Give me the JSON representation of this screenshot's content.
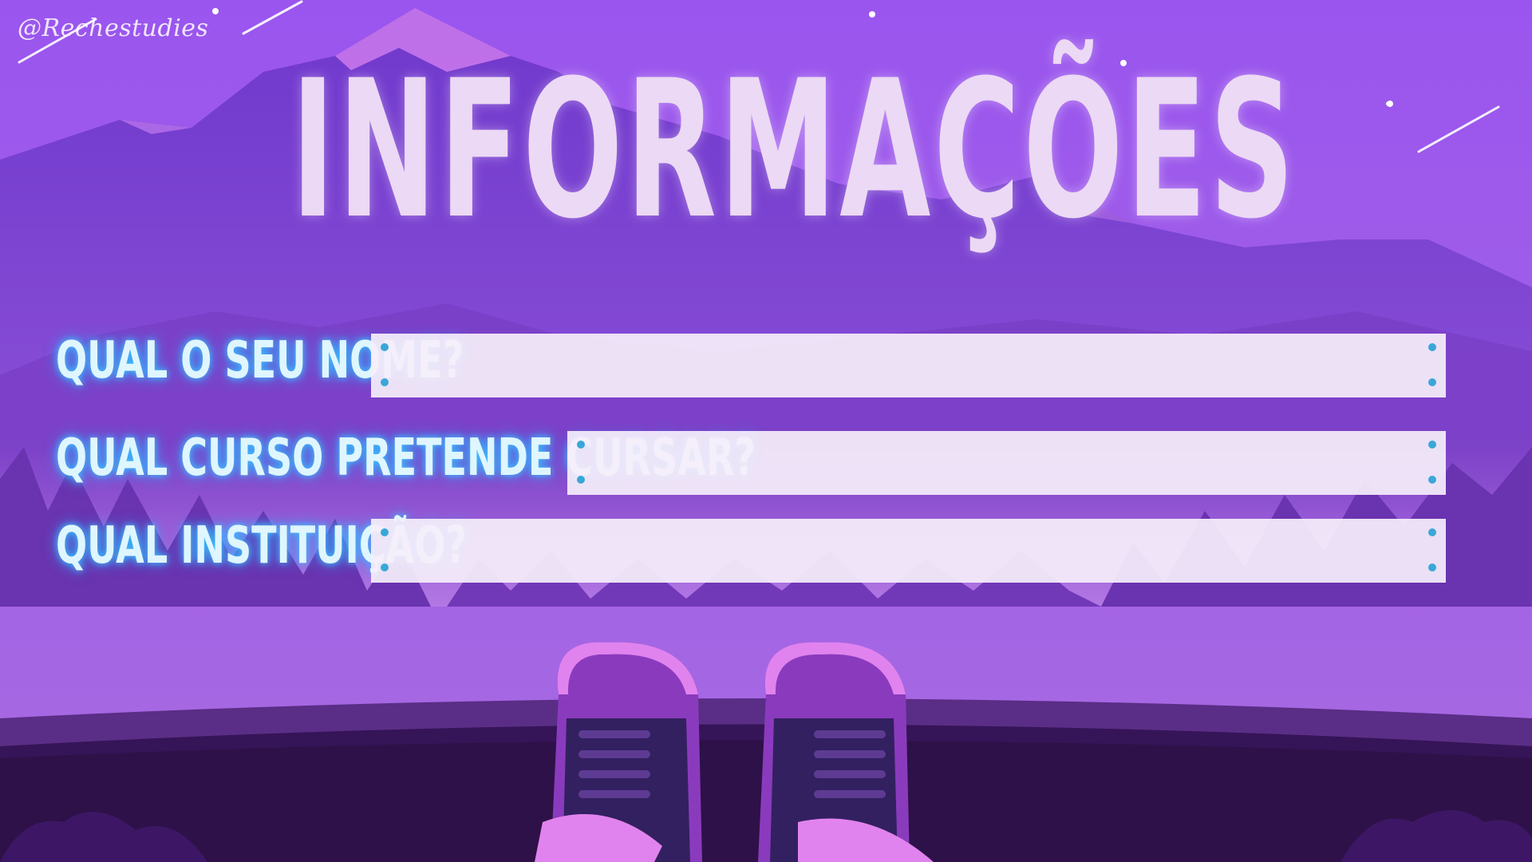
{
  "watermark": "@Rechestudies",
  "title": "INFORMAÇÕES",
  "questions": [
    {
      "label": "QUAL O SEU NOME?",
      "value": ""
    },
    {
      "label": "QUAL CURSO PRETENDE CURSAR?",
      "value": ""
    },
    {
      "label": "QUAL INSTITUIÇÃO?",
      "value": ""
    }
  ],
  "colors": {
    "sky_top": "#9a55ee",
    "mountain": "#6a35c4",
    "forest": "#5a2aa0",
    "ground": "#2e1148",
    "title": "#ecd9f5",
    "label_glow": "#3ec8ff",
    "box": "#f5eefa",
    "box_dot": "#3aa7d8"
  }
}
